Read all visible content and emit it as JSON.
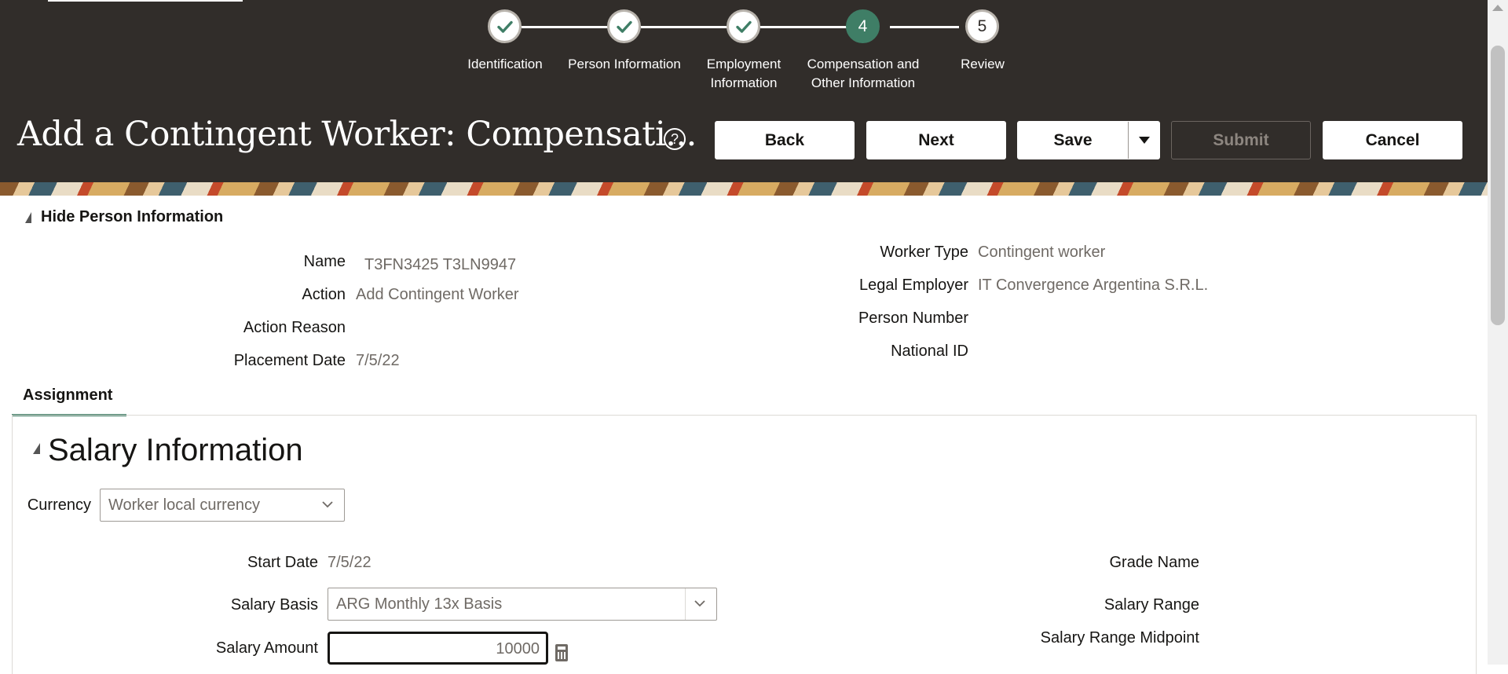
{
  "train": {
    "steps": [
      {
        "label": "Identification",
        "state": "complete"
      },
      {
        "label": "Person Information",
        "state": "complete"
      },
      {
        "label": "Employment\nInformation",
        "state": "complete"
      },
      {
        "label": "Compensation and\nOther Information",
        "state": "current",
        "number": "4"
      },
      {
        "label": "Review",
        "state": "upcoming",
        "number": "5"
      }
    ]
  },
  "header": {
    "title": "Add a Contingent Worker: Compensati...",
    "help_glyph": "?",
    "buttons": {
      "back": "Back",
      "next": "Next",
      "save": "Save",
      "submit": "Submit",
      "cancel": "Cancel"
    }
  },
  "person_info": {
    "toggle_label": "Hide Person Information",
    "fields": {
      "name_label": "Name",
      "name_value": "T3FN3425 T3LN9947",
      "action_label": "Action",
      "action_value": "Add Contingent Worker",
      "action_reason_label": "Action Reason",
      "placement_date_label": "Placement Date",
      "placement_date_value": "7/5/22",
      "worker_type_label": "Worker Type",
      "worker_type_value": "Contingent worker",
      "legal_employer_label": "Legal Employer",
      "legal_employer_value": "IT Convergence Argentina S.R.L.",
      "person_number_label": "Person Number",
      "national_id_label": "National ID"
    }
  },
  "tabs": {
    "assignment": "Assignment"
  },
  "salary": {
    "section_title": "Salary Information",
    "currency_label": "Currency",
    "currency_value": "Worker local currency",
    "start_date_label": "Start Date",
    "start_date_value": "7/5/22",
    "salary_basis_label": "Salary Basis",
    "salary_basis_value": "ARG Monthly 13x Basis",
    "salary_amount_label": "Salary Amount",
    "salary_amount_value": "10000",
    "grade_name_label": "Grade Name",
    "salary_range_label": "Salary Range",
    "salary_range_midpoint_label": "Salary Range Midpoint"
  },
  "icons": {
    "check": "check-icon",
    "help": "help-icon",
    "dropdown": "chevron-down-icon",
    "calculator": "calculator-icon"
  },
  "colors": {
    "header_bg": "#312d2a",
    "current_step": "#3f7e66",
    "tab_underline": "#3f7e66"
  }
}
